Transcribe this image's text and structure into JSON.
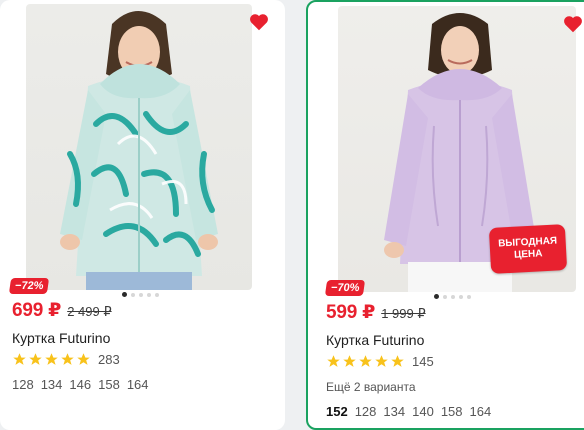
{
  "colors": {
    "sale_red": "#e8212f",
    "accent_green": "#1aa260",
    "star_yellow": "#f8c21b"
  },
  "cards": [
    {
      "discount": "−72%",
      "price": "699 ₽",
      "old_price": "2 499 ₽",
      "title": "Куртка Futurino",
      "rating_stars": 5,
      "reviews": "283",
      "sizes": [
        "128",
        "134",
        "146",
        "158",
        "164"
      ],
      "heart_icon": "heart-filled-icon",
      "photo_dots": 5,
      "active_dot": 1
    },
    {
      "discount": "−70%",
      "price": "599 ₽",
      "old_price": "1 999 ₽",
      "title": "Куртка Futurino",
      "rating_stars": 5,
      "reviews": "145",
      "variants": "Ещё 2 варианта",
      "promo_line1": "ВЫГОДНАЯ",
      "promo_line2": "ЦЕНА",
      "sizes": [
        "152",
        "128",
        "134",
        "140",
        "158",
        "164"
      ],
      "selected_size": "152",
      "heart_icon": "heart-filled-icon",
      "photo_dots": 5,
      "active_dot": 1
    }
  ]
}
